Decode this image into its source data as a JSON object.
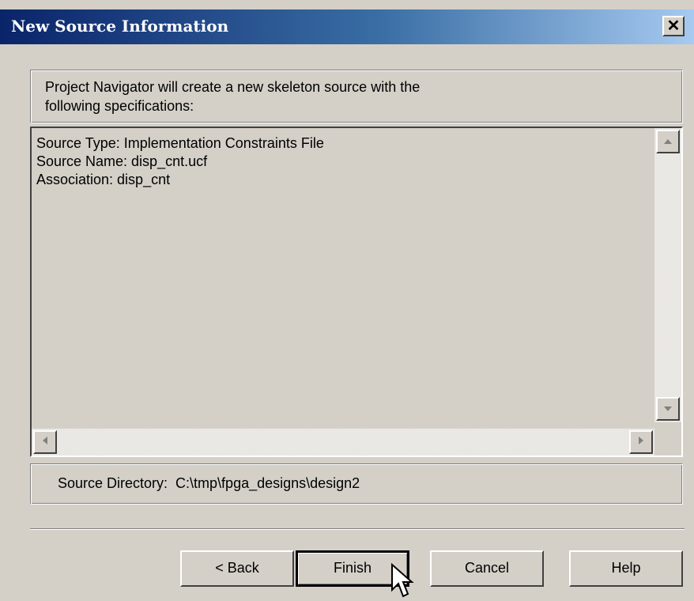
{
  "window": {
    "title": "New Source Information",
    "close_label": "✕"
  },
  "description": {
    "line1": "Project Navigator will create a new skeleton source with the",
    "line2": "following specifications:"
  },
  "specs": {
    "source_type": "Source Type:  Implementation Constraints File",
    "source_name": "Source Name:  disp_cnt.ucf",
    "association": "Association:  disp_cnt"
  },
  "directory": {
    "label": "Source Directory:",
    "value": "C:\\tmp\\fpga_designs\\design2"
  },
  "buttons": {
    "back": "< Back",
    "finish": "Finish",
    "cancel": "Cancel",
    "help": "Help"
  },
  "colors": {
    "face": "#d4d0c8",
    "title_start": "#0a246a",
    "title_end": "#a6caf0"
  }
}
